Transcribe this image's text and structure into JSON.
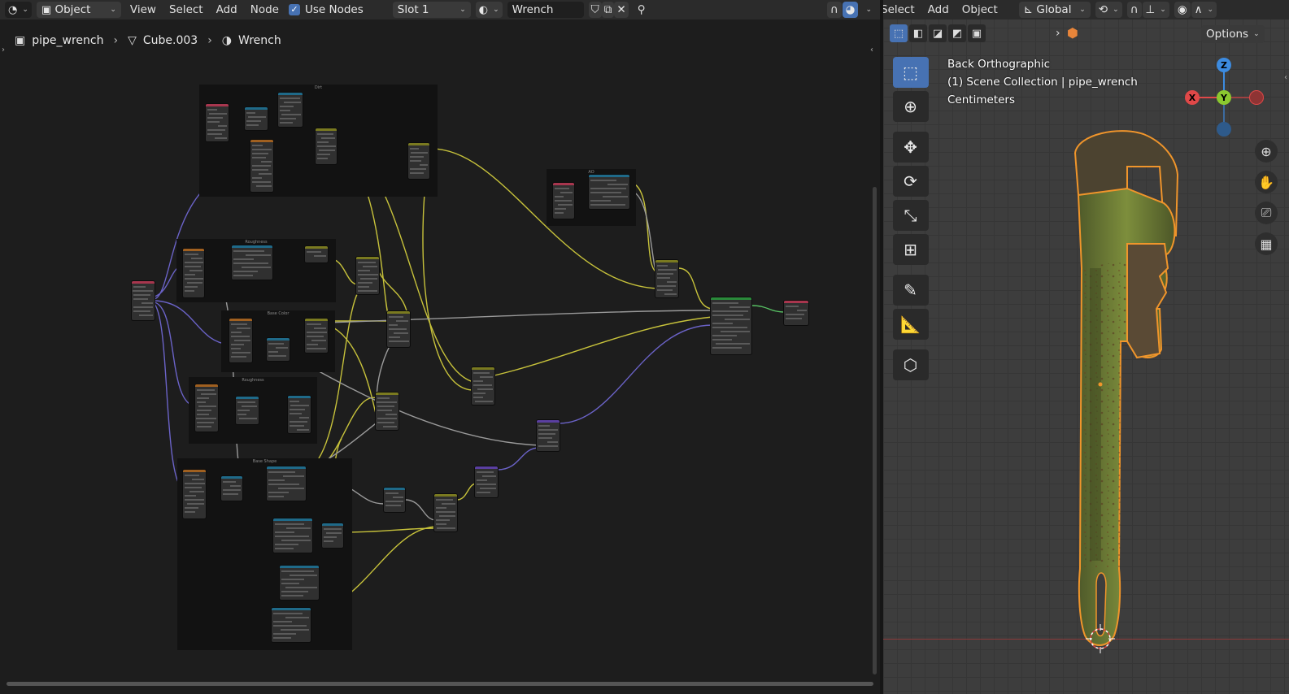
{
  "node_editor": {
    "header": {
      "editor_type_icon": "shader-editor-icon",
      "mode": "Object",
      "menus": [
        "View",
        "Select",
        "Add",
        "Node"
      ],
      "use_nodes_label": "Use Nodes",
      "use_nodes_checked": true,
      "slot": "Slot 1",
      "material_name": "Wrench"
    },
    "breadcrumb": {
      "object": "pipe_wrench",
      "mesh": "Cube.003",
      "material": "Wrench"
    },
    "frames": [
      "Dirt",
      "AO",
      "Roughness",
      "Base Color",
      "Roughness",
      "Base Shape"
    ]
  },
  "viewport": {
    "header": {
      "menus": [
        "Select",
        "Add",
        "Object"
      ],
      "transform_orientation": "Global",
      "options_label": "Options"
    },
    "info": {
      "view_name": "Back Orthographic",
      "collection": "(1) Scene Collection | pipe_wrench",
      "units": "Centimeters"
    },
    "gizmo_labels": {
      "x": "X",
      "y": "Y",
      "z": "Z"
    },
    "colors": {
      "selection_outline": "#f0952b",
      "active_tool": "#4772b3",
      "gizmo_x": "#e04848",
      "gizmo_y": "#8bc82f",
      "gizmo_z": "#3c8be0"
    }
  }
}
